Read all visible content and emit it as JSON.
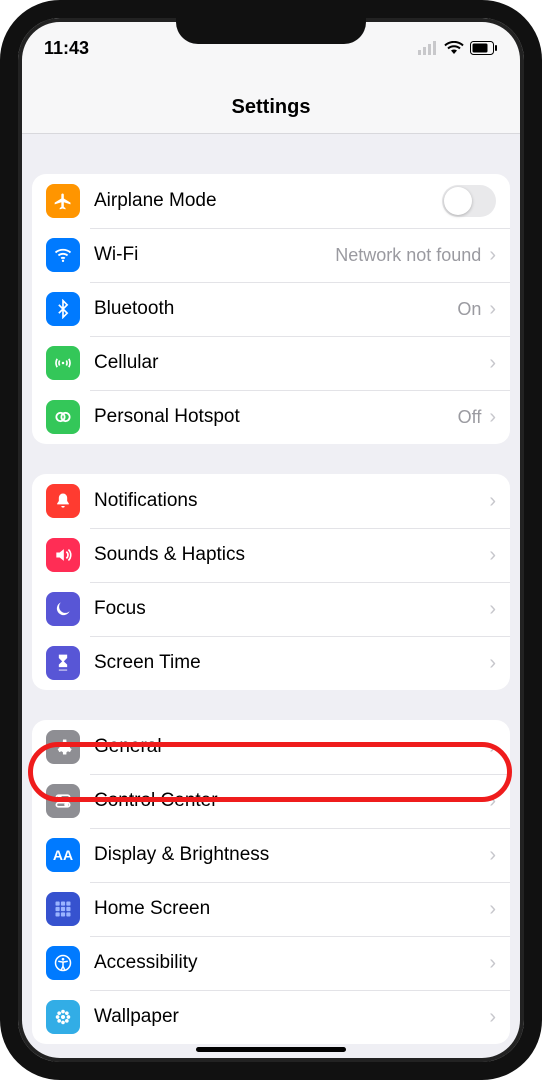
{
  "status": {
    "time": "11:43"
  },
  "header": {
    "title": "Settings"
  },
  "groups": [
    {
      "rows": [
        {
          "id": "airplane",
          "label": "Airplane Mode",
          "icon": "airplane-icon",
          "color": "#ff9500",
          "control": "toggle",
          "toggle_on": false
        },
        {
          "id": "wifi",
          "label": "Wi-Fi",
          "icon": "wifi-icon",
          "color": "#007aff",
          "detail": "Network not found",
          "chevron": true
        },
        {
          "id": "bluetooth",
          "label": "Bluetooth",
          "icon": "bluetooth-icon",
          "color": "#007aff",
          "detail": "On",
          "chevron": true
        },
        {
          "id": "cellular",
          "label": "Cellular",
          "icon": "cellular-icon",
          "color": "#34c759",
          "chevron": true
        },
        {
          "id": "hotspot",
          "label": "Personal Hotspot",
          "icon": "hotspot-icon",
          "color": "#34c759",
          "detail": "Off",
          "chevron": true
        }
      ]
    },
    {
      "rows": [
        {
          "id": "notifications",
          "label": "Notifications",
          "icon": "bell-icon",
          "color": "#ff3b30",
          "chevron": true
        },
        {
          "id": "sounds",
          "label": "Sounds & Haptics",
          "icon": "speaker-icon",
          "color": "#ff2d55",
          "chevron": true
        },
        {
          "id": "focus",
          "label": "Focus",
          "icon": "moon-icon",
          "color": "#5856d6",
          "chevron": true
        },
        {
          "id": "screentime",
          "label": "Screen Time",
          "icon": "hourglass-icon",
          "color": "#5856d6",
          "chevron": true
        }
      ]
    },
    {
      "rows": [
        {
          "id": "general",
          "label": "General",
          "icon": "gear-icon",
          "color": "#8e8e93",
          "chevron": true,
          "highlighted": true
        },
        {
          "id": "controlcenter",
          "label": "Control Center",
          "icon": "switches-icon",
          "color": "#8e8e93",
          "chevron": true
        },
        {
          "id": "display",
          "label": "Display & Brightness",
          "icon": "aa-icon",
          "color": "#007aff",
          "chevron": true
        },
        {
          "id": "homescreen",
          "label": "Home Screen",
          "icon": "grid-icon",
          "color": "#3652cf",
          "chevron": true
        },
        {
          "id": "accessibility",
          "label": "Accessibility",
          "icon": "accessibility-icon",
          "color": "#007aff",
          "chevron": true
        },
        {
          "id": "wallpaper",
          "label": "Wallpaper",
          "icon": "flower-icon",
          "color": "#32ade6",
          "chevron": true
        }
      ]
    }
  ]
}
